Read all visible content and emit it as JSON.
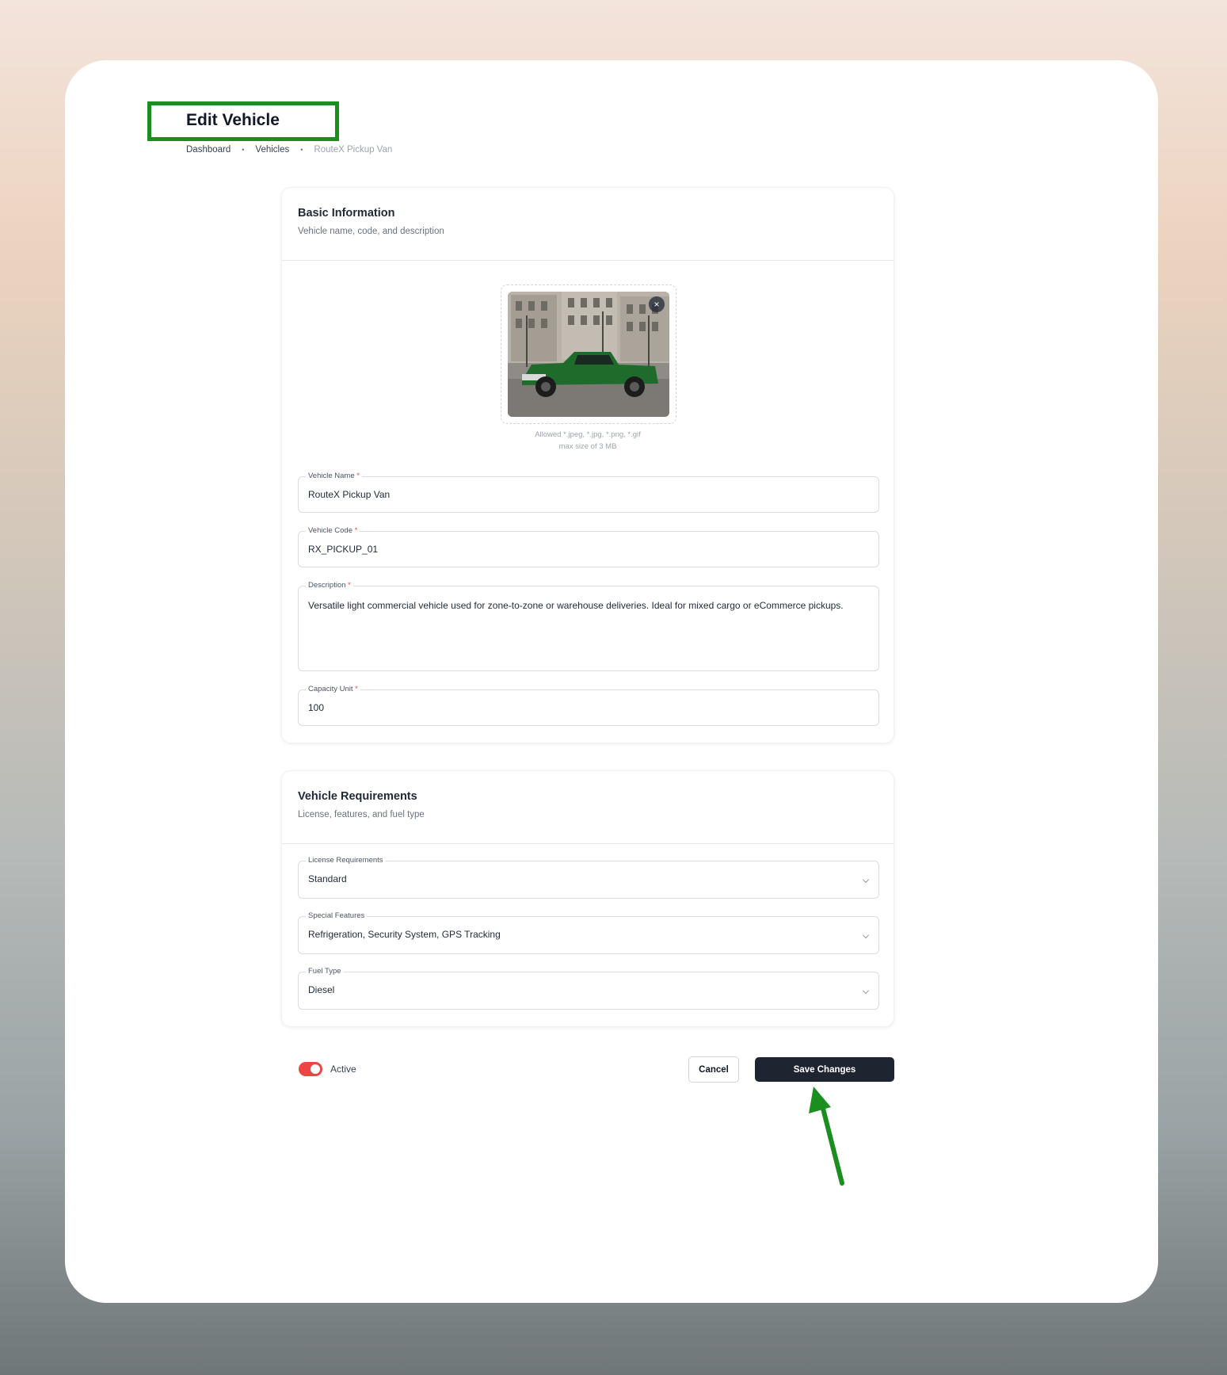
{
  "page": {
    "title": "Edit Vehicle",
    "breadcrumb": [
      "Dashboard",
      "Vehicles",
      "RouteX Pickup Van"
    ],
    "breadcrumb_sep": "•"
  },
  "basic": {
    "title": "Basic Information",
    "subtitle": "Vehicle name, code, and description",
    "upload_note_1": "Allowed *.jpeg, *.jpg, *.png, *.gif",
    "upload_note_2": "max size of 3 MB",
    "remove_icon": "×",
    "fields": {
      "name": {
        "label": "Vehicle Name",
        "value": "RouteX Pickup Van"
      },
      "code": {
        "label": "Vehicle Code",
        "value": "RX_PICKUP_01"
      },
      "description": {
        "label": "Description",
        "value": "Versatile light commercial vehicle used for zone-to-zone or warehouse deliveries. Ideal for mixed cargo or eCommerce pickups."
      },
      "capacity": {
        "label": "Capacity Unit",
        "value": "100"
      }
    },
    "required_mark": "*"
  },
  "requirements": {
    "title": "Vehicle Requirements",
    "subtitle": "License, features, and fuel type",
    "fields": {
      "license": {
        "label": "License Requirements",
        "value": "Standard"
      },
      "features": {
        "label": "Special Features",
        "value": "Refrigeration, Security System, GPS Tracking"
      },
      "fuel": {
        "label": "Fuel Type",
        "value": "Diesel"
      }
    }
  },
  "footer": {
    "active_label": "Active",
    "active": true,
    "cancel_label": "Cancel",
    "save_label": "Save Changes"
  },
  "colors": {
    "highlight": "#1a8f1f",
    "toggle_on": "#ef4444",
    "primary_button": "#1f2530",
    "required": "#ef4444"
  }
}
